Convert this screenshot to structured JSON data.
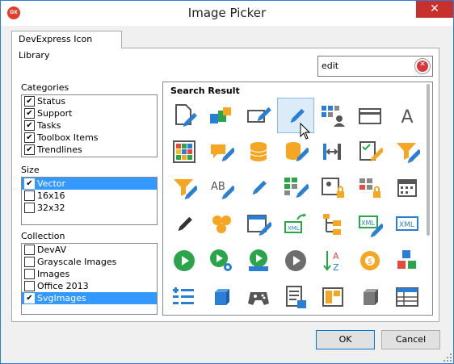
{
  "window": {
    "title": "Image Picker",
    "app_icon_label": "DX",
    "close_glyph": "✕"
  },
  "tab": {
    "label": "DevExpress Icon Library"
  },
  "search": {
    "value": "edit"
  },
  "categories": {
    "label": "Categories",
    "items": [
      {
        "label": "Status",
        "checked": true
      },
      {
        "label": "Support",
        "checked": true
      },
      {
        "label": "Tasks",
        "checked": true
      },
      {
        "label": "Toolbox Items",
        "checked": true
      },
      {
        "label": "Trendlines",
        "checked": true
      }
    ]
  },
  "size": {
    "label": "Size",
    "items": [
      {
        "label": "Vector",
        "checked": true,
        "selected": true
      },
      {
        "label": "16x16",
        "checked": false
      },
      {
        "label": "32x32",
        "checked": false
      }
    ]
  },
  "collection": {
    "label": "Collection",
    "items": [
      {
        "label": "DevAV",
        "checked": false
      },
      {
        "label": "Grayscale Images",
        "checked": false
      },
      {
        "label": "Images",
        "checked": false
      },
      {
        "label": "Office 2013",
        "checked": false
      },
      {
        "label": "SvgImages",
        "checked": true,
        "selected": true
      }
    ]
  },
  "results": {
    "title": "Search Result",
    "selected_index": 3,
    "icons": [
      "document-edit-icon",
      "shapes-edit-icon",
      "rectangle-edit-icon",
      "pencil-icon",
      "user-tiles-icon",
      "card-icon",
      "text-letter-a-icon",
      "color-grid-icon",
      "comment-edit-icon",
      "database-icon",
      "database-edit-icon",
      "column-resize-icon",
      "checklist-edit-icon",
      "filter-edit-icon",
      "filter-edit-icon",
      "text-ab-edit-icon",
      "pencil-small-icon",
      "grid-edit-icon",
      "contact-lock-icon",
      "grid-lock-icon",
      "calendar-icon",
      "pencil-dark-icon",
      "hexagons-icon",
      "window-edit-icon",
      "export-xml-icon",
      "tree-folders-icon",
      "xml-edit-icon",
      "xml-icon",
      "play-icon",
      "play-settings-icon",
      "play-monitor-icon",
      "play-gray-icon",
      "sort-a-z-icon",
      "gear-dollar-icon",
      "colored-cubes-icon",
      "list-add-icon",
      "blue-cube-icon",
      "gamepad-icon",
      "document-lines-icon",
      "layout-orange-icon",
      "gray-cube-icon",
      "window-table-icon"
    ]
  },
  "buttons": {
    "ok": "OK",
    "cancel": "Cancel"
  }
}
